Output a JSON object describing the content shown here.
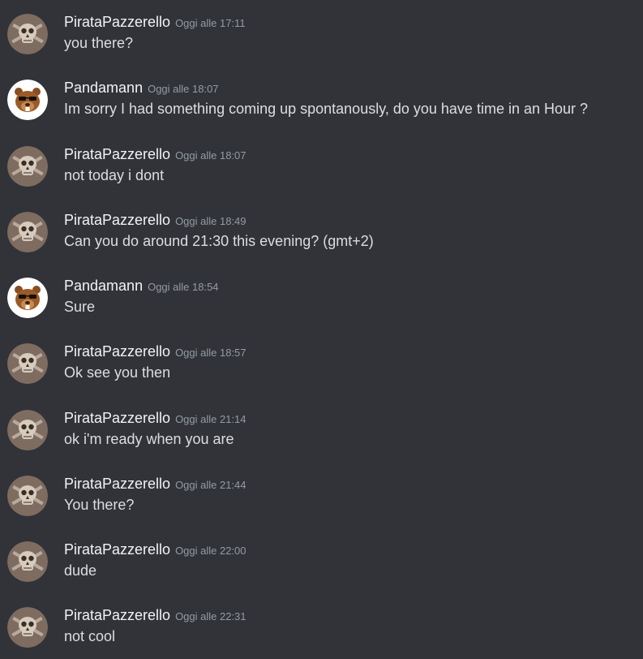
{
  "colors": {
    "background": "#313338",
    "author": "#f2f3f5",
    "timestamp": "#949ba4",
    "message_text": "#dbdee1"
  },
  "messages": [
    {
      "author": "PirataPazzerello",
      "avatar": "skull-avatar-icon",
      "timestamp": "Oggi alle 17:11",
      "text": "you there?"
    },
    {
      "author": "Pandamann",
      "avatar": "beaver-avatar-icon",
      "timestamp": "Oggi alle 18:07",
      "text": "Im sorry I had something coming up spontanously, do you have time in an Hour ?"
    },
    {
      "author": "PirataPazzerello",
      "avatar": "skull-avatar-icon",
      "timestamp": "Oggi alle 18:07",
      "text": "not today i dont"
    },
    {
      "author": "PirataPazzerello",
      "avatar": "skull-avatar-icon",
      "timestamp": "Oggi alle 18:49",
      "text": "Can you do around 21:30 this evening? (gmt+2)"
    },
    {
      "author": "Pandamann",
      "avatar": "beaver-avatar-icon",
      "timestamp": "Oggi alle 18:54",
      "text": "Sure"
    },
    {
      "author": "PirataPazzerello",
      "avatar": "skull-avatar-icon",
      "timestamp": "Oggi alle 18:57",
      "text": "Ok see you then"
    },
    {
      "author": "PirataPazzerello",
      "avatar": "skull-avatar-icon",
      "timestamp": "Oggi alle 21:14",
      "text": "ok i'm ready when you are"
    },
    {
      "author": "PirataPazzerello",
      "avatar": "skull-avatar-icon",
      "timestamp": "Oggi alle 21:44",
      "text": "You there?"
    },
    {
      "author": "PirataPazzerello",
      "avatar": "skull-avatar-icon",
      "timestamp": "Oggi alle 22:00",
      "text": "dude"
    },
    {
      "author": "PirataPazzerello",
      "avatar": "skull-avatar-icon",
      "timestamp": "Oggi alle 22:31",
      "text": "not cool"
    }
  ]
}
